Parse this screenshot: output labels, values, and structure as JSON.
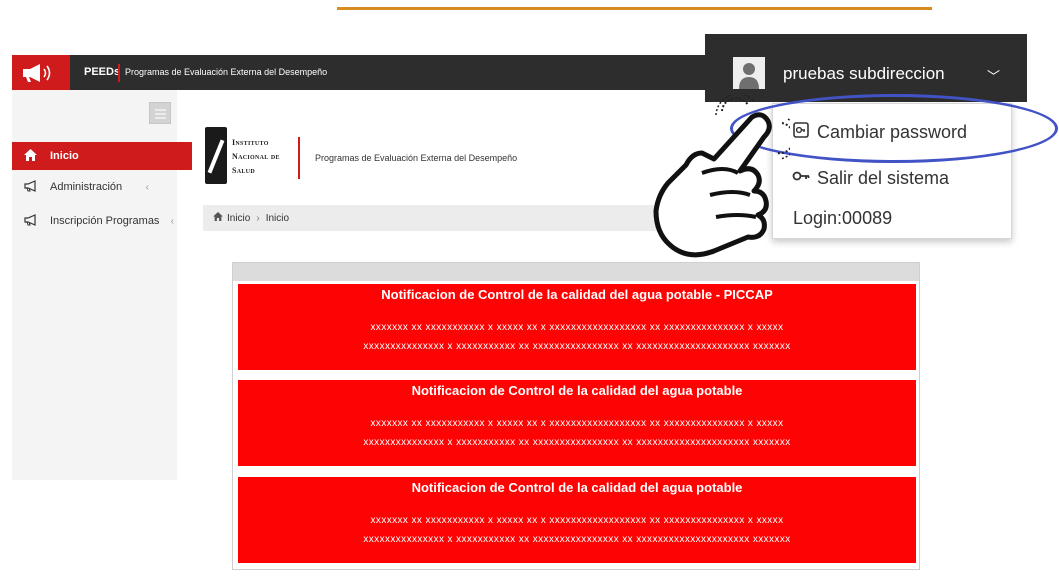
{
  "topbar": {
    "brand": "PEEDs",
    "subtitle": "Programas de Evaluación Externa del Desempeño",
    "icon": "megaphone-icon"
  },
  "user": {
    "name": "pruebas subdireccion",
    "avatar_icon": "user-avatar-icon",
    "dropdown_icon": "chevron-down-icon"
  },
  "dropdown": {
    "change_password": "Cambiar password",
    "change_password_icon": "key-box-icon",
    "logout": "Salir del sistema",
    "logout_icon": "key-icon",
    "login": "Login:00089"
  },
  "sidebar": {
    "items": [
      {
        "label": "Inicio",
        "icon": "home-icon",
        "active": true
      },
      {
        "label": "Administración",
        "icon": "megaphone-icon",
        "active": false
      },
      {
        "label": "Inscripción Programas",
        "icon": "megaphone-icon",
        "active": false
      }
    ]
  },
  "institute": {
    "line1": "Instituto",
    "line2": "Nacional de",
    "line3": "Salud",
    "program": "Programas de Evaluación Externa del Desempeño"
  },
  "breadcrumb": {
    "home": "Inicio",
    "current": "Inicio"
  },
  "notifications": [
    {
      "title": "Notificacion de Control de la calidad del agua potable - PICCAP",
      "line1": "xxxxxxx xx xxxxxxxxxxx x xxxxx xx x xxxxxxxxxxxxxxxxxx  xx xxxxxxxxxxxxxxx x  xxxxx",
      "line2": "xxxxxxxxxxxxxxx x xxxxxxxxxxx xx xxxxxxxxxxxxxxxx xx xxxxxxxxxxxxxxxxxxxxx xxxxxxx"
    },
    {
      "title": "Notificacion de Control de la calidad del agua potable",
      "line1": "xxxxxxx xx xxxxxxxxxxx x xxxxx xx x xxxxxxxxxxxxxxxxxx  xx xxxxxxxxxxxxxxx x  xxxxx",
      "line2": "xxxxxxxxxxxxxxx x xxxxxxxxxxx xx xxxxxxxxxxxxxxxx xx xxxxxxxxxxxxxxxxxxxxx xxxxxxx"
    },
    {
      "title": "Notificacion de Control de la calidad del agua potable",
      "line1": "xxxxxxx xx xxxxxxxxxxx x xxxxx xx x xxxxxxxxxxxxxxxxxx  xx xxxxxxxxxxxxxxx x  xxxxx",
      "line2": "xxxxxxxxxxxxxxx x xxxxxxxxxxx xx xxxxxxxxxxxxxxxx xx xxxxxxxxxxxxxxxxxxxxx xxxxxxx"
    }
  ],
  "colors": {
    "brand_red": "#cf1b1b",
    "notification_red": "#fd0303",
    "topbar_dark": "#2d2d2d",
    "highlight_blue": "#4253c6",
    "accent_orange": "#d88c1e"
  },
  "annotation": {
    "pointer_icon": "pointing-hand-icon"
  }
}
